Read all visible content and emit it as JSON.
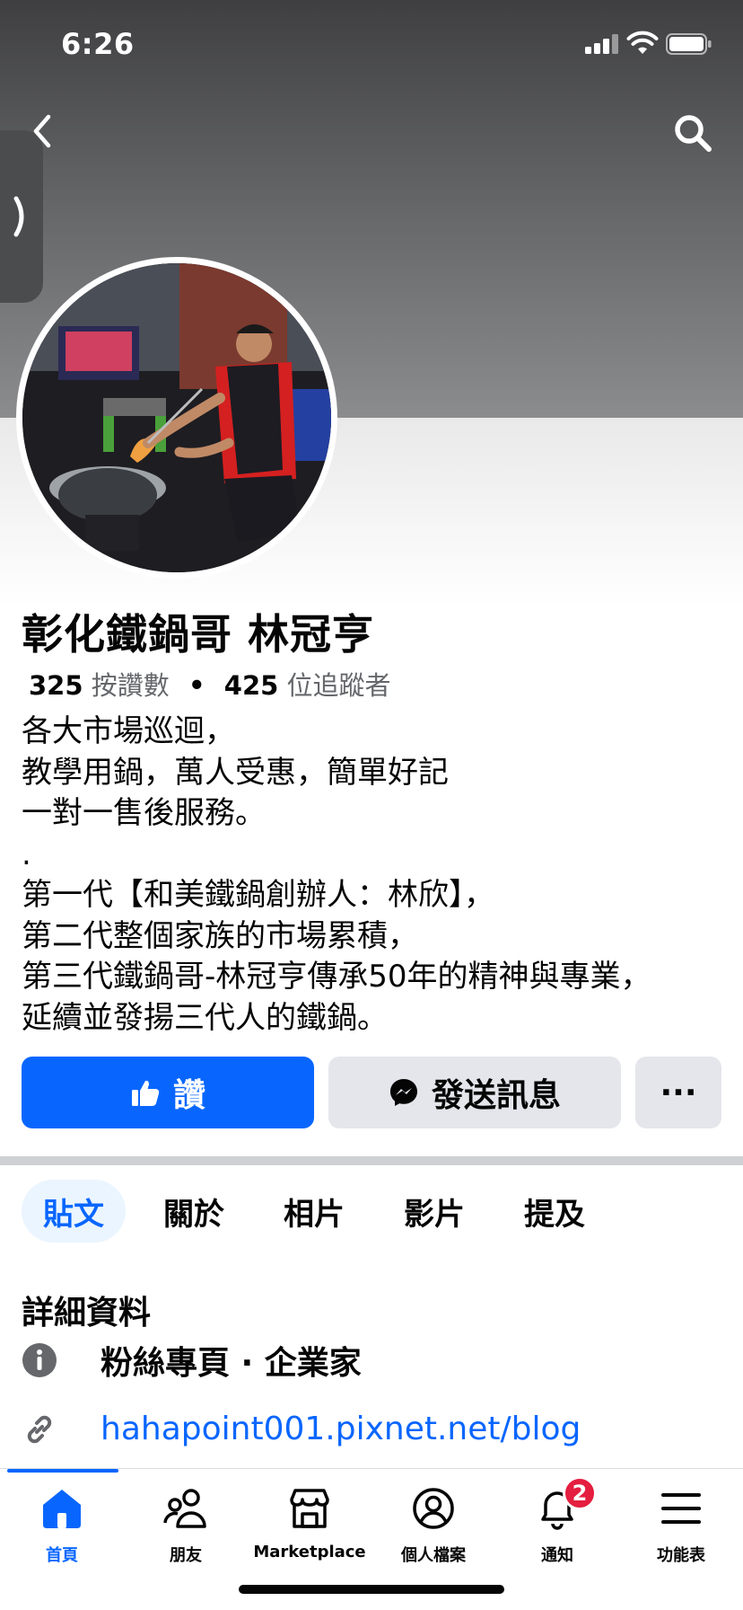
{
  "status_bar": {
    "time": "6:26"
  },
  "profile": {
    "name": "彰化鐵鍋哥 林冠亨",
    "likes_count": "325",
    "likes_label": "按讚數",
    "separator": "•",
    "followers_count": "425",
    "followers_label": "位追蹤者",
    "bio": "各大市場巡迴，\n教學用鍋，萬人受惠，簡單好記\n一對一售後服務。\n.\n第一代【和美鐵鍋創辦人：林欣】，\n第二代整個家族的市場累積，\n第三代鐵鍋哥-林冠亨傳承50年的精神與專業，\n延續並發揚三代人的鐵鍋。"
  },
  "actions": {
    "like_label": "讚",
    "message_label": "發送訊息",
    "more_label": "···"
  },
  "tabs": [
    {
      "label": "貼文",
      "active": true
    },
    {
      "label": "關於",
      "active": false
    },
    {
      "label": "相片",
      "active": false
    },
    {
      "label": "影片",
      "active": false
    },
    {
      "label": "提及",
      "active": false
    }
  ],
  "details": {
    "title": "詳細資料",
    "page_type": "粉絲專頁 · 企業家",
    "website": "hahapoint001.pixnet.net/blog"
  },
  "bottom_nav": [
    {
      "label": "首頁",
      "icon": "home-icon",
      "active": true
    },
    {
      "label": "朋友",
      "icon": "friends-icon",
      "active": false
    },
    {
      "label": "Marketplace",
      "icon": "marketplace-icon",
      "active": false
    },
    {
      "label": "個人檔案",
      "icon": "profile-icon",
      "active": false
    },
    {
      "label": "通知",
      "icon": "bell-icon",
      "active": false,
      "badge": "2"
    },
    {
      "label": "功能表",
      "icon": "menu-icon",
      "active": false
    }
  ],
  "colors": {
    "accent": "#0866ff",
    "secondary_button": "#e4e6eb",
    "badge": "#e41e3f"
  }
}
